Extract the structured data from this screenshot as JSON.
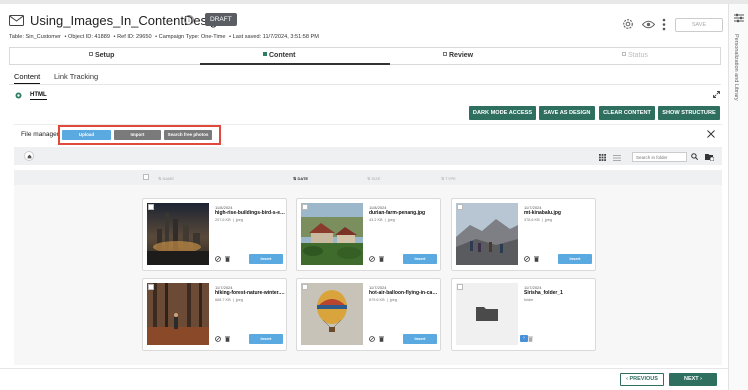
{
  "header": {
    "title": "Using_Images_In_ContentDesigner",
    "draft_badge": "DRAFT",
    "meta": {
      "table": "Table: Sin_Customer",
      "object_id": "Object ID: 41889",
      "ref_id": "Ref ID: 29650",
      "campaign_type": "Campaign Type: One-Time",
      "last_saved": "Last saved: 11/7/2024, 3:51:58 PM"
    },
    "save_label": "SAVE"
  },
  "right_rail": {
    "label": "Personalization and Library"
  },
  "steps": [
    {
      "label": "Setup",
      "state": "done"
    },
    {
      "label": "Content",
      "state": "active"
    },
    {
      "label": "Review",
      "state": "todo"
    },
    {
      "label": "Status",
      "state": "disabled"
    }
  ],
  "subtabs": {
    "content": "Content",
    "link_tracking": "Link Tracking"
  },
  "editor": {
    "html_label": "HTML"
  },
  "actions": {
    "dark_mode": "DARK MODE ACCESS",
    "save_as_design": "SAVE AS DESIGN",
    "clear_content": "CLEAR CONTENT",
    "show_structure": "SHOW STRUCTURE"
  },
  "file_manager": {
    "title": "File manager",
    "upload": "Upload",
    "import": "Import",
    "search_free_photos": "Search free photos",
    "search_placeholder": "Search in folder",
    "columns": {
      "name": "NAME",
      "date": "DATE",
      "size": "SIZE",
      "type": "TYPE"
    },
    "insert_label": "Insert",
    "files": [
      {
        "date": "11/8/2024",
        "name": "high-rise-buildings-bird-s-eye.jpg",
        "size": "207.6 KB",
        "type": "jpeg"
      },
      {
        "date": "11/8/2024",
        "name": "durian-farm-penang.jpg",
        "size": "43.2 KB",
        "type": "jpeg"
      },
      {
        "date": "11/7/2024",
        "name": "mt-kinabalu.jpg",
        "size": "378.6 KB",
        "type": "jpeg"
      },
      {
        "date": "11/7/2024",
        "name": "hiking-forest-nature-winter.jpg",
        "size": "668.7 KB",
        "type": "jpeg"
      },
      {
        "date": "11/7/2024",
        "name": "hot-air-balloon-flying-in-cappadocia.jpg",
        "size": "879.6 KB",
        "type": "jpeg"
      },
      {
        "date": "11/7/2024",
        "name": "Sirisha_folder_1",
        "size": "",
        "type": "folder"
      }
    ]
  },
  "footer": {
    "previous": "PREVIOUS",
    "next": "NEXT"
  },
  "colors": {
    "accent": "#2e6f60",
    "upload": "#5aa9e0",
    "highlight": "#e04a3c"
  }
}
